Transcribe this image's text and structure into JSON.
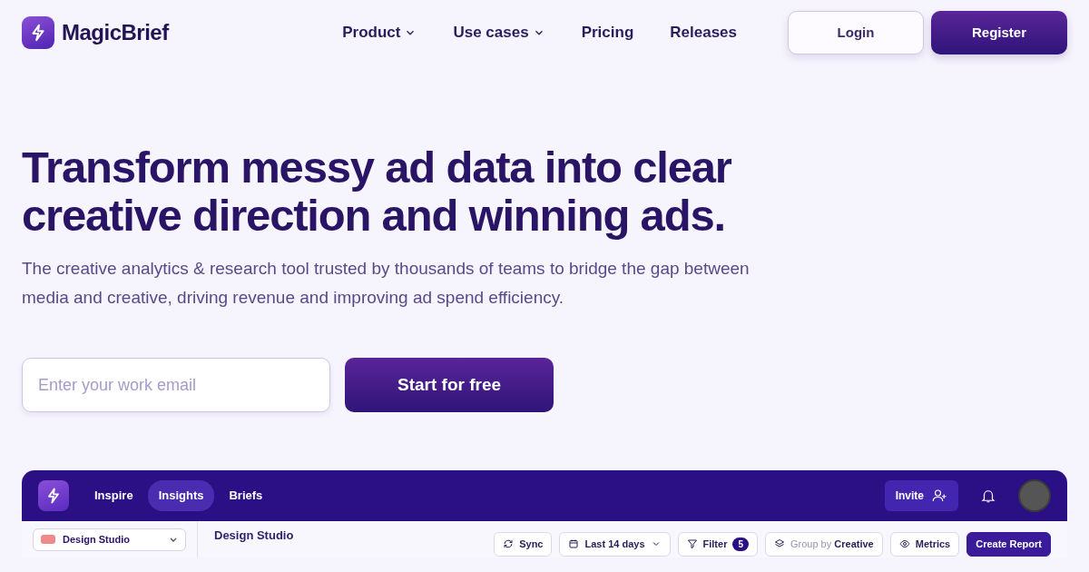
{
  "brand": {
    "name": "MagicBrief"
  },
  "nav": [
    {
      "label": "Product",
      "dropdown": true
    },
    {
      "label": "Use cases",
      "dropdown": true
    },
    {
      "label": "Pricing",
      "dropdown": false
    },
    {
      "label": "Releases",
      "dropdown": false
    }
  ],
  "auth": {
    "login": "Login",
    "register": "Register"
  },
  "hero": {
    "title": "Transform messy ad data into clear creative direction and winning ads.",
    "subtitle": "The creative analytics & research tool trusted by thousands of teams to bridge the gap between media and creative, driving revenue and improving ad spend efficiency.",
    "email_placeholder": "Enter your work email",
    "cta": "Start for free"
  },
  "app": {
    "tabs": [
      {
        "label": "Inspire",
        "selected": false
      },
      {
        "label": "Insights",
        "selected": true
      },
      {
        "label": "Briefs",
        "selected": false
      }
    ],
    "invite": "Invite",
    "workspace": {
      "name": "Design Studio",
      "color": "#f08a8a"
    },
    "page_title": "Design Studio",
    "toolbar": [
      {
        "kind": "sync",
        "label": "Sync"
      },
      {
        "kind": "date",
        "label": "Last 14 days"
      },
      {
        "kind": "filter",
        "label": "Filter",
        "count": "5"
      },
      {
        "kind": "group",
        "label": "Group by **Creative**"
      },
      {
        "kind": "metrics",
        "label": "Metrics"
      },
      {
        "kind": "primary",
        "label": "Create Report"
      }
    ]
  }
}
